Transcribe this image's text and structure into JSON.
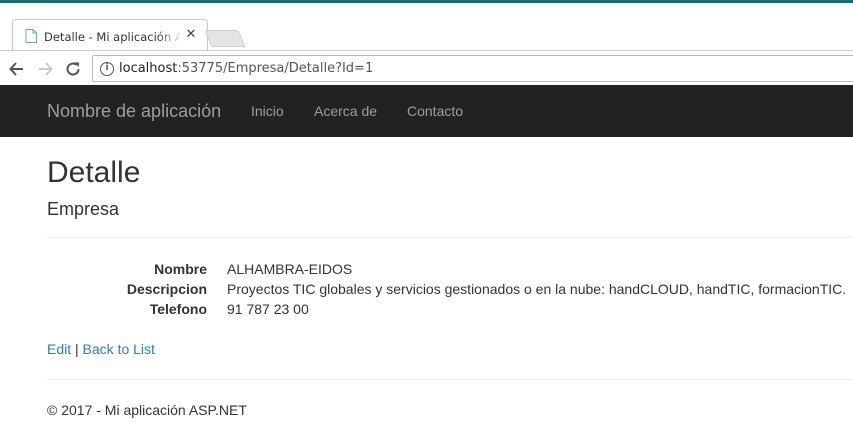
{
  "browser": {
    "tab_title": "Detalle - Mi aplicación ASP.NET",
    "tab_close": "✕",
    "url_host": "localhost",
    "url_rest": ":53775/Empresa/Detalle?Id=1",
    "icons": {
      "back": "arrow-left-icon",
      "forward": "arrow-right-icon",
      "reload": "reload-icon",
      "info": "info-icon",
      "favicon": "document-icon"
    }
  },
  "navbar": {
    "brand": "Nombre de aplicación",
    "links": [
      "Inicio",
      "Acerca de",
      "Contacto"
    ],
    "background": "#222222",
    "text_color": "#9d9d9d"
  },
  "page": {
    "title": "Detalle",
    "subtitle": "Empresa",
    "fields": [
      {
        "label": "Nombre",
        "value": "ALHAMBRA-EIDOS"
      },
      {
        "label": "Descripcion",
        "value": "Proyectos TIC globales y servicios gestionados o en la nube: handCLOUD, handTIC, formacionTIC."
      },
      {
        "label": "Telefono",
        "value": "91 787 23 00"
      }
    ],
    "actions": {
      "edit": "Edit",
      "separator": "|",
      "back": "Back to List"
    },
    "link_color": "#337ab7",
    "footer": "© 2017 - Mi aplicación ASP.NET"
  }
}
